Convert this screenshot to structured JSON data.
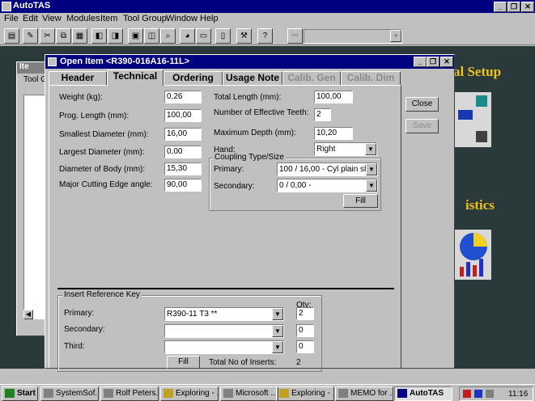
{
  "app": {
    "title": "AutoTAS",
    "min": "_",
    "restore": "❐",
    "close": "✕"
  },
  "menu": [
    "File",
    "Edit",
    "View",
    "Modules",
    "Item",
    "Tool Group",
    "Window",
    "Help"
  ],
  "toolbar": {
    "combo_value": "",
    "combo_arrow": "▼"
  },
  "background": {
    "text_setup": "al Setup",
    "text_istics": "istics",
    "list_window_title": "Ite",
    "list_window_label": "Tool G"
  },
  "dialog": {
    "title": "Open Item <R390-016A16-11L>",
    "tabs": [
      {
        "label": "Header",
        "state": "normal"
      },
      {
        "label": "Technical",
        "state": "active"
      },
      {
        "label": "Ordering",
        "state": "normal"
      },
      {
        "label": "Usage Note",
        "state": "normal"
      },
      {
        "label": "Calib. Gen",
        "state": "disabled"
      },
      {
        "label": "Calib. Dim",
        "state": "disabled"
      }
    ],
    "left_fields": [
      {
        "label": "Weight (kg):",
        "value": "0,26"
      },
      {
        "label": "Prog. Length (mm):",
        "value": "100,00"
      },
      {
        "label": "Smallest Diameter (mm):",
        "value": "16,00"
      },
      {
        "label": "Largest Diameter (mm):",
        "value": "0,00"
      },
      {
        "label": "Diameter of Body (mm):",
        "value": "15,30"
      },
      {
        "label": "Major Cutting Edge angle:",
        "value": "90,00"
      }
    ],
    "right_fields": [
      {
        "label": "Total Length (mm):",
        "value": "100,00"
      },
      {
        "label": "Number of Effective Teeth:",
        "value": "2"
      },
      {
        "label": "Maximum Depth (mm):",
        "value": "10,20"
      }
    ],
    "hand": {
      "label": "Hand:",
      "value": "Right"
    },
    "coupling": {
      "title": "Coupling Type/Size",
      "primary_label": "Primary:",
      "primary_value": "100 / 16,00 - Cyl plain shar",
      "secondary_label": "Secondary:",
      "secondary_value": "0 / 0,00 -",
      "fill_label": "Fill"
    },
    "insert": {
      "title": "Insert Reference Key",
      "qty_label": "Qty:",
      "rows": [
        {
          "label": "Primary:",
          "value": "R390-11 T3 **",
          "qty": "2"
        },
        {
          "label": "Secondary:",
          "value": "",
          "qty": "0"
        },
        {
          "label": "Third:",
          "value": "",
          "qty": "0"
        }
      ],
      "fill_label": "Fill",
      "total_label": "Total No of Inserts:",
      "total_value": "2"
    },
    "buttons": {
      "close": "Close",
      "save": "Save"
    }
  },
  "taskbar": {
    "start": "Start",
    "tasks": [
      {
        "label": "SystemSof...",
        "pressed": false
      },
      {
        "label": "Rolf Peters...",
        "pressed": false
      },
      {
        "label": "Exploring - ...",
        "pressed": false
      },
      {
        "label": "Microsoft ...",
        "pressed": false
      },
      {
        "label": "Exploring - ...",
        "pressed": false
      },
      {
        "label": "MEMO for ...",
        "pressed": false
      },
      {
        "label": "AutoTAS",
        "pressed": true
      }
    ],
    "clock": "11:16"
  }
}
